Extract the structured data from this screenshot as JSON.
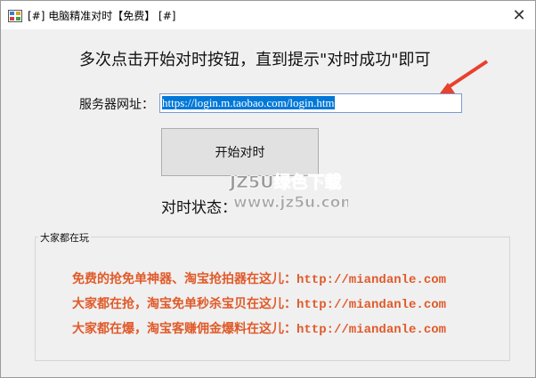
{
  "window": {
    "title": "[#] 电脑精准对时【免费】 [#]",
    "close_glyph": "✕"
  },
  "main": {
    "headline": "多次点击开始对时按钮，直到提示\"对时成功\"即可",
    "server_label": "服务器网址：",
    "server_url": "https://login.m.taobao.com/login.htm",
    "start_button": "开始对时",
    "status_label": "对时状态："
  },
  "watermark": {
    "line1": "JZ5U绿色下载",
    "line2": "www.jz5u.com"
  },
  "group": {
    "title": "大家都在玩",
    "links": [
      {
        "text": "免费的抢免单神器、淘宝抢拍器在这儿：",
        "url": "http://miandanle.com"
      },
      {
        "text": "大家都在抢，淘宝免单秒杀宝贝在这儿：",
        "url": "http://miandanle.com"
      },
      {
        "text": "大家都在爆，淘宝客赚佣金爆料在这儿：",
        "url": "http://miandanle.com"
      }
    ]
  },
  "colors": {
    "promo_text": "#e05a2a",
    "selection": "#0078d7",
    "arrow": "#e8412c"
  }
}
